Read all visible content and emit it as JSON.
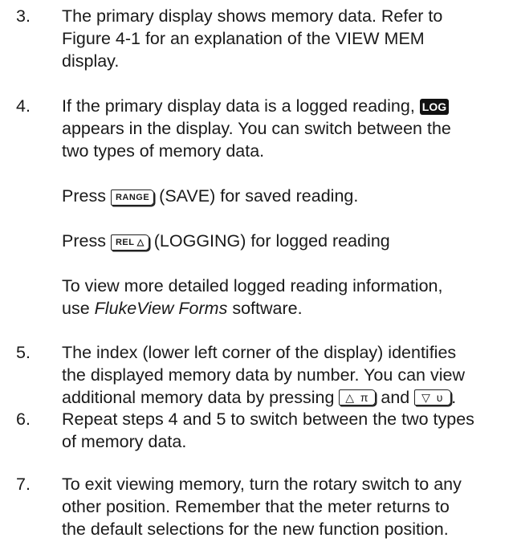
{
  "steps": [
    {
      "number": "3.",
      "lines": [
        "The primary display shows memory data. Refer to",
        "Figure 4-1 for an explanation of the VIEW MEM",
        "display."
      ]
    },
    {
      "number": "4.",
      "line1_pre": "If the primary display data is a logged reading,",
      "badge": "LOG",
      "line2": "appears in the display. You can switch between the",
      "line3": "two types of memory data."
    },
    {
      "number": "5.",
      "lines": [
        "The index (lower left corner of the display) identifies",
        "the displayed memory data by number. You can view"
      ],
      "line3_pre": "additional memory data by pressing",
      "and": "and",
      "end": "."
    },
    {
      "number": "6.",
      "lines": [
        "Repeat steps 4 and 5 to switch between the two types",
        "of memory data."
      ]
    },
    {
      "number": "7.",
      "lines": [
        "To exit viewing memory, turn the rotary switch to any",
        "other position. Remember that the meter returns to",
        "the default selections for the new function position."
      ]
    }
  ],
  "press_range": {
    "pre": "Press",
    "key": "RANGE",
    "post": "(SAVE) for saved reading."
  },
  "press_rel": {
    "pre": "Press",
    "key": "REL △",
    "post": "(LOGGING) for logged reading"
  },
  "view_more": {
    "line1": "To view more detailed logged reading information,",
    "line2_pre": "use",
    "software_name": "FlukeView Forms",
    "line2_post": "software."
  },
  "keys": {
    "up": "△ π",
    "down": "▽ υ"
  }
}
